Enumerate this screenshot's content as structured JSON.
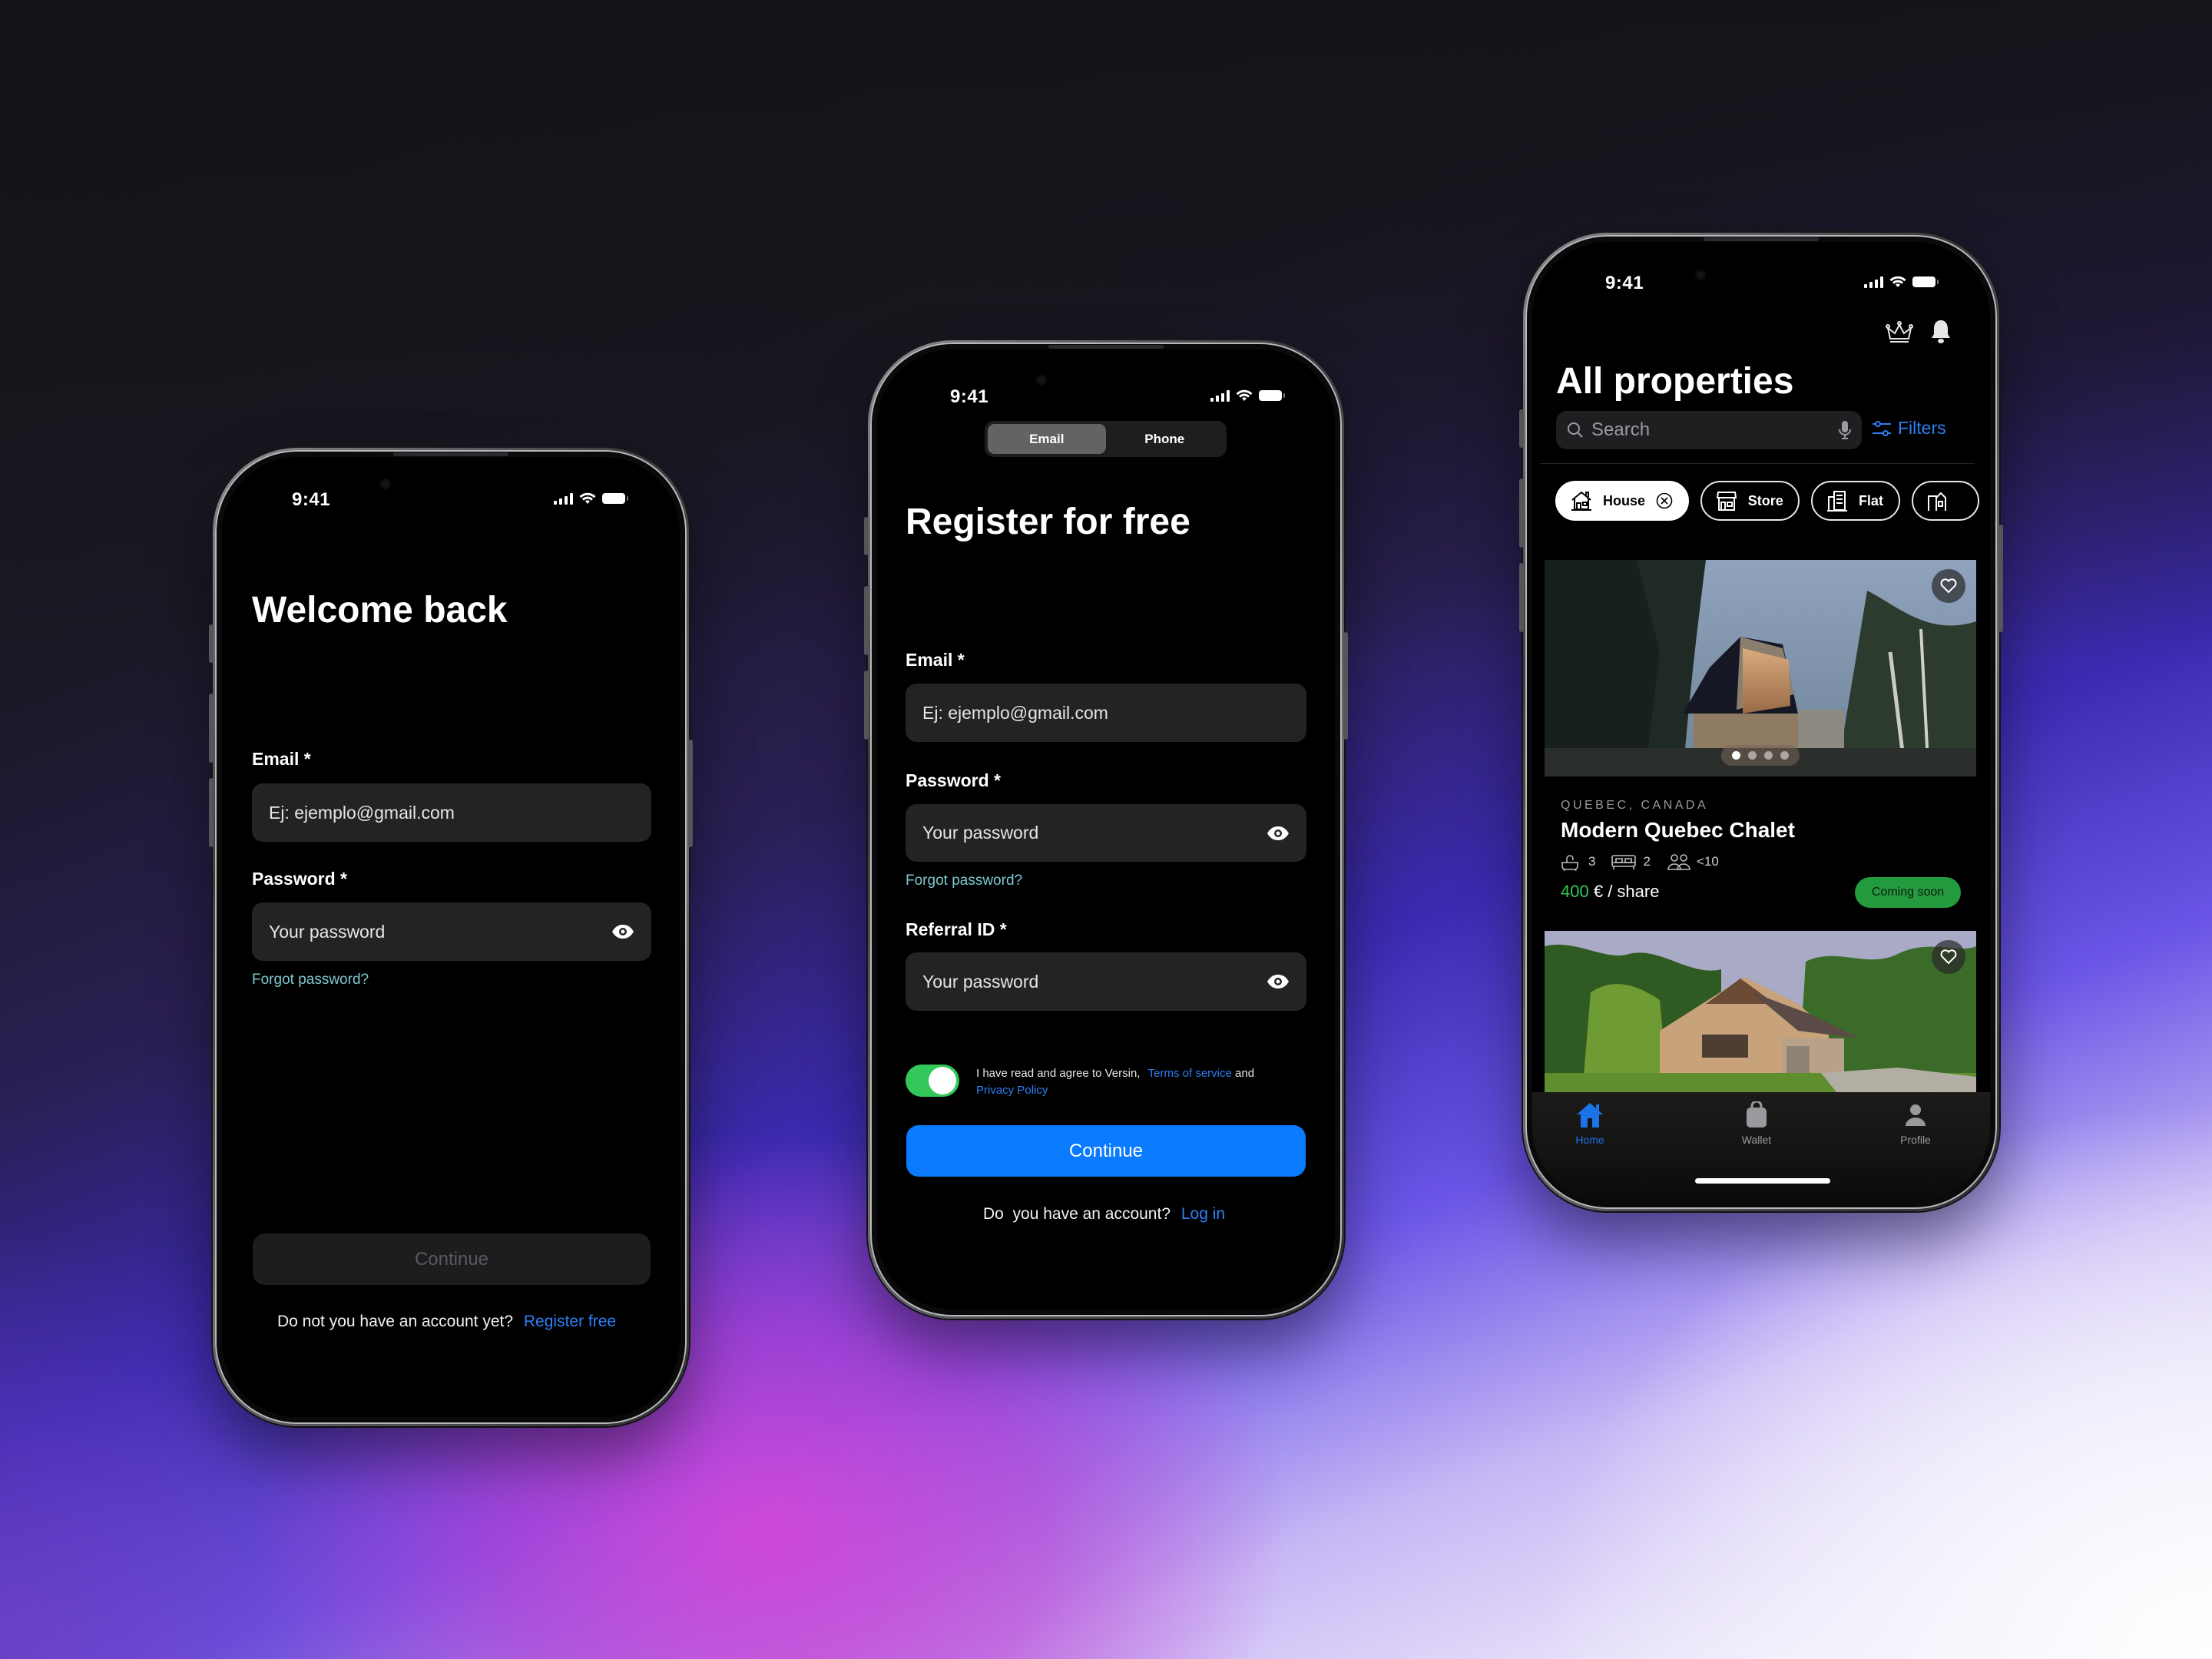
{
  "status_bar": {
    "time": "9:41"
  },
  "login": {
    "title": "Welcome back",
    "email_label": "Email *",
    "email_placeholder": "Ej: ejemplo@gmail.com",
    "password_label": "Password *",
    "password_placeholder": "Your password",
    "forgot": "Forgot password?",
    "continue": "Continue",
    "footer_text": "Do not you have an account yet?",
    "footer_link": "Register free"
  },
  "register": {
    "segments": [
      {
        "label": "Email",
        "selected": true
      },
      {
        "label": "Phone",
        "selected": false
      }
    ],
    "title": "Register for free",
    "email_label": "Email *",
    "email_placeholder": "Ej: ejemplo@gmail.com",
    "password_label": "Password *",
    "password_placeholder": "Your password",
    "forgot": "Forgot password?",
    "referral_label": "Referral ID *",
    "referral_placeholder": "Your password",
    "terms_toggle_on": true,
    "terms_prefix": "I have read and agree to Versin,",
    "terms_link": "Terms of service",
    "terms_and": "and",
    "privacy_link": "Privacy Policy",
    "continue": "Continue",
    "footer_text": "Do  you have an account?",
    "footer_link": "Log in"
  },
  "properties": {
    "title": "All properties",
    "search_placeholder": "Search",
    "filters": "Filters",
    "chips": [
      {
        "label": "House",
        "icon": "house-icon",
        "selected": true
      },
      {
        "label": "Store",
        "icon": "store-icon",
        "selected": false
      },
      {
        "label": "Flat",
        "icon": "flat-icon",
        "selected": false
      },
      {
        "label": "",
        "icon": "building-icon",
        "selected": false
      }
    ],
    "listings": [
      {
        "location": "QUEBEC, CANADA",
        "name": "Modern Quebec Chalet",
        "baths": "3",
        "beds": "2",
        "guests": "<10",
        "price": "400",
        "price_suffix": "€ / share",
        "status": "Coming soon",
        "photo_index": 1,
        "photo_count": 4
      },
      {
        "location": "",
        "name": ""
      }
    ],
    "tabs": [
      {
        "label": "Home",
        "active": true
      },
      {
        "label": "Wallet",
        "active": false
      },
      {
        "label": "Profile",
        "active": false
      }
    ]
  },
  "colors": {
    "accent_blue": "#0a7aff",
    "link_blue": "#2f7ef5",
    "forgot_teal": "#7ec8d2",
    "toggle_green": "#34c759",
    "badge_green": "#249a3e"
  }
}
